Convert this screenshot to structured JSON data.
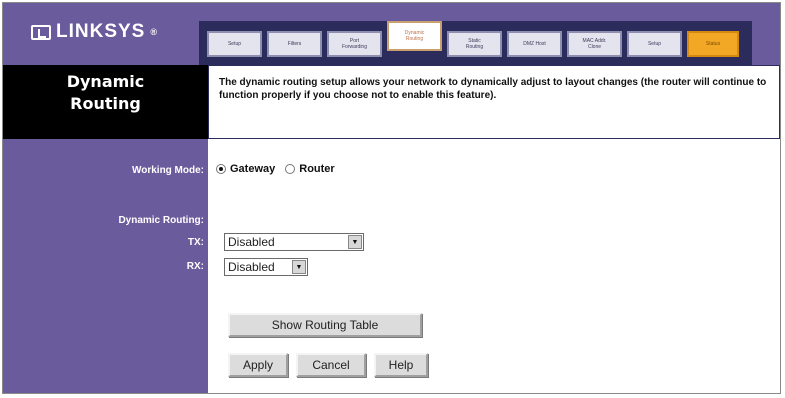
{
  "brand": {
    "name": "LINKSYS",
    "mark": "®"
  },
  "tabs": [
    {
      "label": "Setup",
      "state": "normal"
    },
    {
      "label": "Filters",
      "state": "normal"
    },
    {
      "label": "Port\nForwarding",
      "state": "normal"
    },
    {
      "label": "Dynamic\nRouting",
      "state": "active"
    },
    {
      "label": "Static\nRouting",
      "state": "normal"
    },
    {
      "label": "DMZ Host",
      "state": "normal"
    },
    {
      "label": "MAC Addr.\nClone",
      "state": "normal"
    },
    {
      "label": "Setup",
      "state": "normal"
    },
    {
      "label": "Status",
      "state": "special"
    }
  ],
  "section": {
    "title_line1": "Dynamic",
    "title_line2": "Routing"
  },
  "description": "The dynamic routing setup allows your network to dynamically adjust to layout changes (the router will continue to function properly if you choose not to enable this feature).",
  "form": {
    "working_mode_label": "Working Mode:",
    "mode_options": {
      "gateway": "Gateway",
      "router": "Router"
    },
    "mode_selected": "Gateway",
    "dynamic_routing_label": "Dynamic Routing:",
    "tx_label": "TX:",
    "tx_value": "Disabled",
    "rx_label": "RX:",
    "rx_value": "Disabled"
  },
  "buttons": {
    "show_routing_table": "Show Routing Table",
    "apply": "Apply",
    "cancel": "Cancel",
    "help": "Help"
  },
  "icons": {
    "dropdown": "chevron-down-icon",
    "logo": "linksys-logo-icon"
  },
  "colors": {
    "sidebar_purple": "#6a5c9c",
    "tab_bar": "#2c2c5c",
    "status_tab": "#f2a825",
    "header_black": "#000000"
  }
}
